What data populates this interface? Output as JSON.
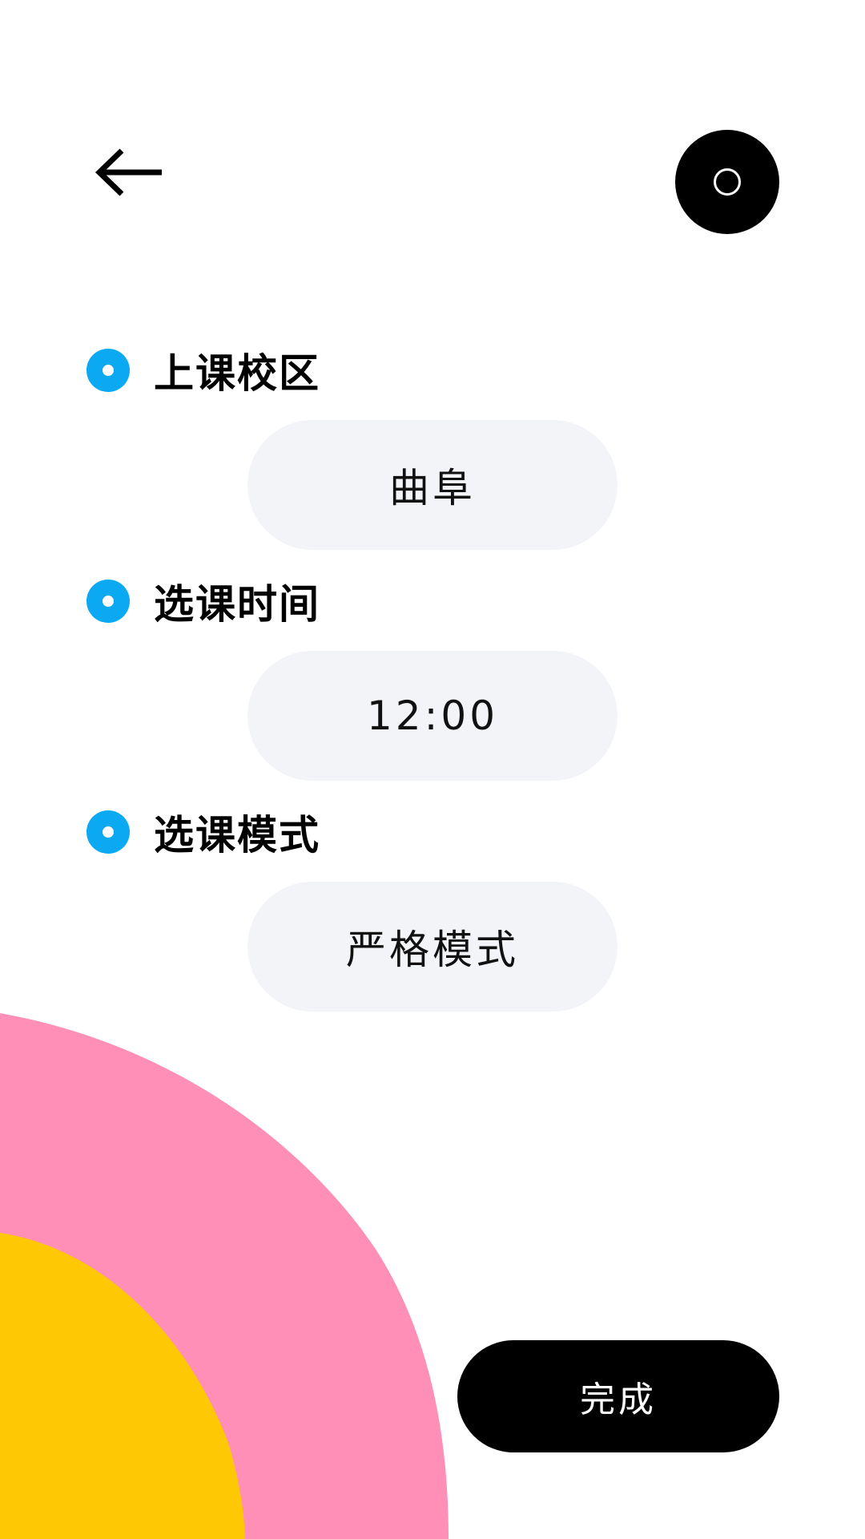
{
  "colors": {
    "bullet": "#0aa9f1",
    "pill_bg": "#f3f4f8",
    "pink": "#ff8fb7",
    "yellow": "#ffc805",
    "button_bg": "#000000",
    "button_text": "#ffffff"
  },
  "header": {
    "back_icon": "arrow-left-icon",
    "toggle_icon": "circle-ring-icon"
  },
  "sections": [
    {
      "label": "上课校区",
      "value": "曲阜"
    },
    {
      "label": "选课时间",
      "value": "12:00"
    },
    {
      "label": "选课模式",
      "value": "严格模式"
    }
  ],
  "footer": {
    "done_label": "完成"
  }
}
